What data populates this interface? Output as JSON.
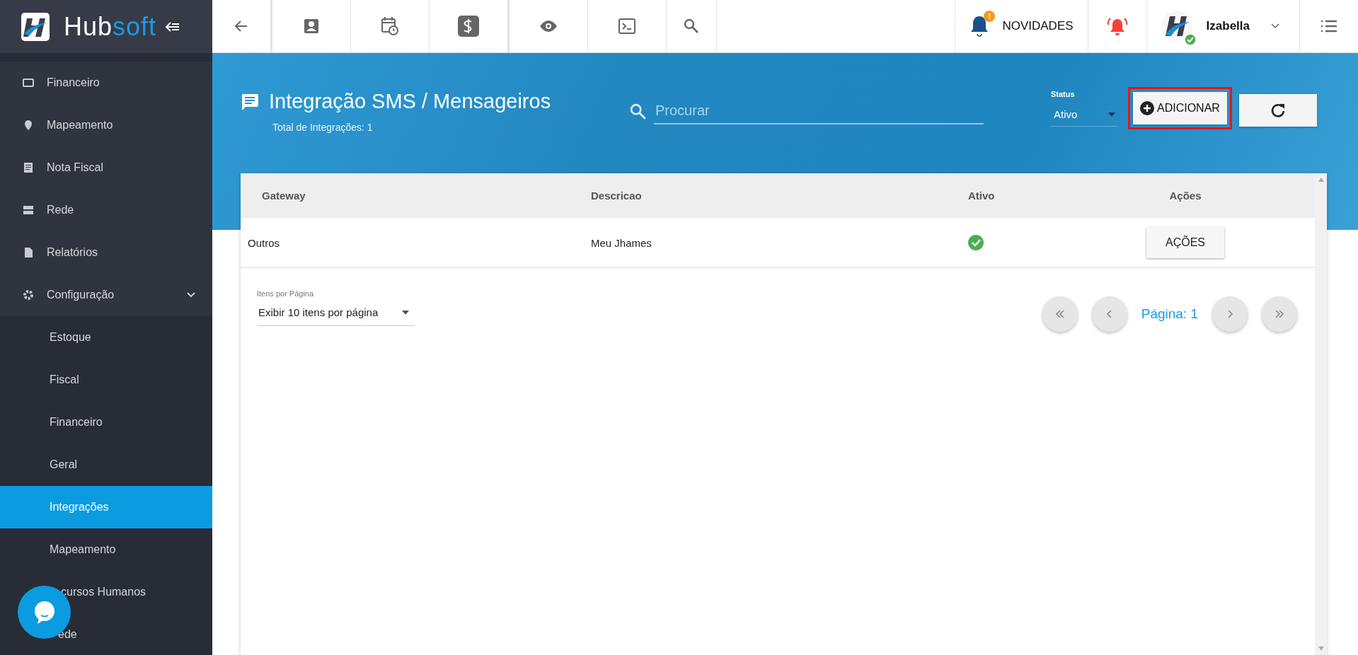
{
  "brand": {
    "name_part_1": "Hub",
    "name_part_2": "soft"
  },
  "topbar": {
    "news_label": "NOVIDADES",
    "news_badge": "!",
    "user_name": "Izabella",
    "user_online": true
  },
  "sidebar": {
    "items": [
      {
        "label": "Financeiro",
        "selected": false
      },
      {
        "label": "Mapeamento",
        "selected": false
      },
      {
        "label": "Nota Fiscal",
        "selected": false
      },
      {
        "label": "Rede",
        "selected": false
      },
      {
        "label": "Relatórios",
        "selected": false
      },
      {
        "label": "Configuração",
        "selected": false,
        "expanded": true,
        "children": [
          {
            "label": "Estoque",
            "selected": false
          },
          {
            "label": "Fiscal",
            "selected": false
          },
          {
            "label": "Financeiro",
            "selected": false
          },
          {
            "label": "Geral",
            "selected": false
          },
          {
            "label": "Integrações",
            "selected": true
          },
          {
            "label": "Mapeamento",
            "selected": false
          },
          {
            "label": "cursos Humanos",
            "selected": false
          },
          {
            "label": "ede",
            "selected": false
          }
        ]
      }
    ]
  },
  "header": {
    "title": "Integração SMS / Mensageiros",
    "subtitle": "Total de Integrações: 1",
    "search": {
      "placeholder": "Procurar"
    },
    "status": {
      "label": "Status",
      "value": "Ativo"
    },
    "add_button": {
      "label": "ADICIONAR",
      "highlighted": true
    }
  },
  "table": {
    "columns": [
      "Gateway",
      "Descricao",
      "Ativo",
      "Ações"
    ],
    "rows": [
      {
        "gateway": "Outros",
        "descricao": "Meu Jhames",
        "ativo": true,
        "action": "AÇÕES"
      }
    ]
  },
  "pagination": {
    "per_page_label": "Itens por Página",
    "per_page_value": "Exibir 10 itens por página",
    "page": "Página: 1"
  }
}
